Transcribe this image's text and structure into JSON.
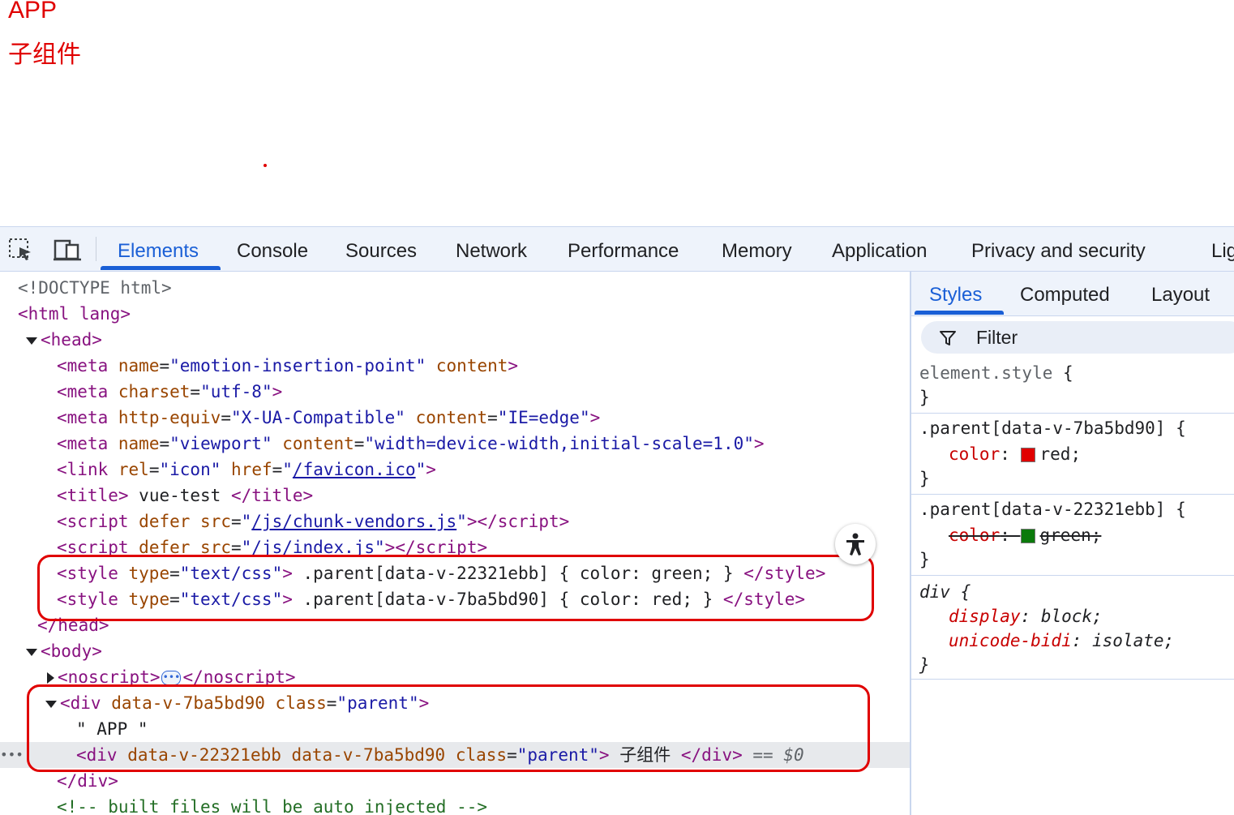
{
  "page": {
    "app_text": "APP",
    "child_text": "子组件"
  },
  "devtools": {
    "tabs": [
      "Elements",
      "Console",
      "Sources",
      "Network",
      "Performance",
      "Memory",
      "Application",
      "Privacy and security",
      "Lig"
    ],
    "active_tab": "Elements",
    "icons": {
      "inspect": "inspect-element-icon",
      "device": "device-toolbar-icon",
      "a11y": "accessibility-icon",
      "filter": "filter-icon"
    },
    "accent_color": "#1a5fd6",
    "highlight_color": "#e00000",
    "elements": {
      "doctype": "<!DOCTYPE html>",
      "html_open": "<html lang>",
      "head_tag": "head",
      "meta1": {
        "tag": "meta",
        "attr1": "name",
        "val1": "emotion-insertion-point",
        "attr2": "content"
      },
      "meta2": {
        "tag": "meta",
        "attr1": "charset",
        "val1": "utf-8"
      },
      "meta3": {
        "tag": "meta",
        "attr1": "http-equiv",
        "val1": "X-UA-Compatible",
        "attr2": "content",
        "val2": "IE=edge"
      },
      "meta4": {
        "tag": "meta",
        "attr1": "name",
        "val1": "viewport",
        "attr2": "content",
        "val2": "width=device-width,initial-scale=1.0"
      },
      "link": {
        "tag": "link",
        "attr1": "rel",
        "val1": "icon",
        "attr2": "href",
        "val2": "/favicon.ico"
      },
      "title": {
        "text": "vue-test"
      },
      "script1": {
        "src": "/js/chunk-vendors.js"
      },
      "script2": {
        "src": "/js/index.js"
      },
      "style1": {
        "type": "text/css",
        "css": ".parent[data-v-22321ebb] { color: green; }"
      },
      "style2": {
        "type": "text/css",
        "css": ".parent[data-v-7ba5bd90] { color: red; }"
      },
      "head_close": "</head>",
      "body_tag": "body",
      "noscript_tag": "noscript",
      "div_outer": {
        "attr1": "data-v-7ba5bd90",
        "attr2": "class",
        "val2": "parent"
      },
      "app_text_node": "\" APP \"",
      "div_inner": {
        "attr1": "data-v-22321ebb",
        "attr2": "data-v-7ba5bd90",
        "attr3": "class",
        "val3": "parent",
        "text": "子组件"
      },
      "selected_marker": "== $0",
      "div_close": "</div>",
      "comment": "<!-- built files will be auto injected -->"
    },
    "styles_pane": {
      "tabs": [
        "Styles",
        "Computed",
        "Layout"
      ],
      "active_tab": "Styles",
      "filter_placeholder": "Filter",
      "rules": [
        {
          "selector": "element.style",
          "props": []
        },
        {
          "selector": ".parent[data-v-7ba5bd90]",
          "props": [
            {
              "name": "color",
              "value": "red",
              "swatch": "#e00000",
              "overridden": false
            }
          ]
        },
        {
          "selector": ".parent[data-v-22321ebb]",
          "props": [
            {
              "name": "color",
              "value": "green",
              "swatch": "#0b7a0b",
              "overridden": true
            }
          ]
        },
        {
          "selector": "div",
          "props": [
            {
              "name": "display",
              "value": "block"
            },
            {
              "name": "unicode-bidi",
              "value": "isolate"
            }
          ]
        }
      ]
    }
  }
}
